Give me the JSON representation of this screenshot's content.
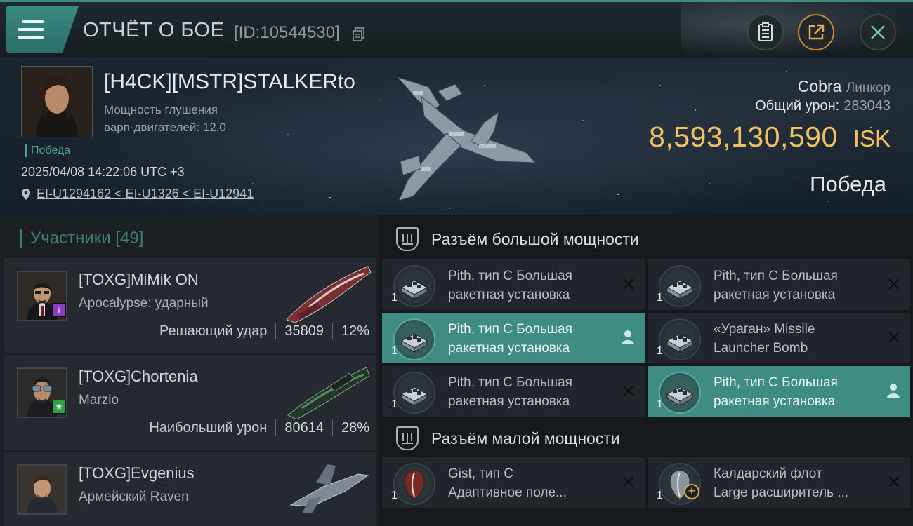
{
  "header": {
    "title": "ОТЧЁТ О БОЕ",
    "battle_id": "[ID:10544530]"
  },
  "victim": {
    "name": "[H4CK][MSTR]STALKERto",
    "warp_jam_line1": "Мощность глушения",
    "warp_jam_line2": "варп-двигателей: 12.0",
    "status": "Победа",
    "timestamp": "2025/04/08 14:22:06 UTC +3",
    "location": "EI-U1294162 < EI-U1326 < EI-U12941",
    "ship_name": "Cobra",
    "ship_class": "Линкор",
    "total_damage_label": "Общий урон:",
    "total_damage_value": "283043",
    "isk_value": "8,593,130,590",
    "isk_unit": "ISK",
    "result": "Победа"
  },
  "participants": {
    "header": "Участники [49]",
    "items": [
      {
        "name": "[TOXG]MiMik ON",
        "ship": "Apocalypse: ударный",
        "stat_label": "Решающий удар",
        "damage": "35809",
        "percent": "12%",
        "badge_color": "#8a3fc4",
        "badge_icon": "info-icon"
      },
      {
        "name": "[TOXG]Chortenia",
        "ship": "Marzio",
        "stat_label": "Наибольший урон",
        "damage": "80614",
        "percent": "28%",
        "badge_color": "#2ea347",
        "badge_icon": "star-icon"
      },
      {
        "name": "[TOXG]Evgenius",
        "ship": "Армейский Raven",
        "stat_label": "",
        "damage": "",
        "percent": ""
      }
    ]
  },
  "fitting": {
    "high_slots": {
      "title": "Разъём большой мощности",
      "modules": [
        {
          "line1": "Pith, тип C Большая",
          "line2": "ракетная установка",
          "qty": "1",
          "highlight": false,
          "action": "close"
        },
        {
          "line1": "Pith, тип C Большая",
          "line2": "ракетная установка",
          "qty": "1",
          "highlight": false,
          "action": "close"
        },
        {
          "line1": "Pith, тип C Большая",
          "line2": "ракетная установка",
          "qty": "1",
          "highlight": true,
          "action": "user"
        },
        {
          "line1": "«Ураган» Missile",
          "line2": "Launcher Bomb",
          "qty": "1",
          "highlight": false,
          "action": "close"
        },
        {
          "line1": "Pith, тип C Большая",
          "line2": "ракетная установка",
          "qty": "1",
          "highlight": false,
          "action": "close"
        },
        {
          "line1": "Pith, тип C Большая",
          "line2": "ракетная установка",
          "qty": "1",
          "highlight": true,
          "action": "user"
        }
      ]
    },
    "low_slots": {
      "title": "Разъём малой мощности",
      "modules": [
        {
          "line1": "Gist, тип C",
          "line2": "Адаптивное поле...",
          "qty": "1",
          "highlight": false,
          "action": "close"
        },
        {
          "line1": "Калдарский флот",
          "line2": "Large расширитель ...",
          "qty": "1",
          "highlight": false,
          "action": "close"
        }
      ]
    }
  },
  "colors": {
    "accent": "#3f8c83",
    "isk": "#f1c062",
    "victory": "#4aa393"
  }
}
